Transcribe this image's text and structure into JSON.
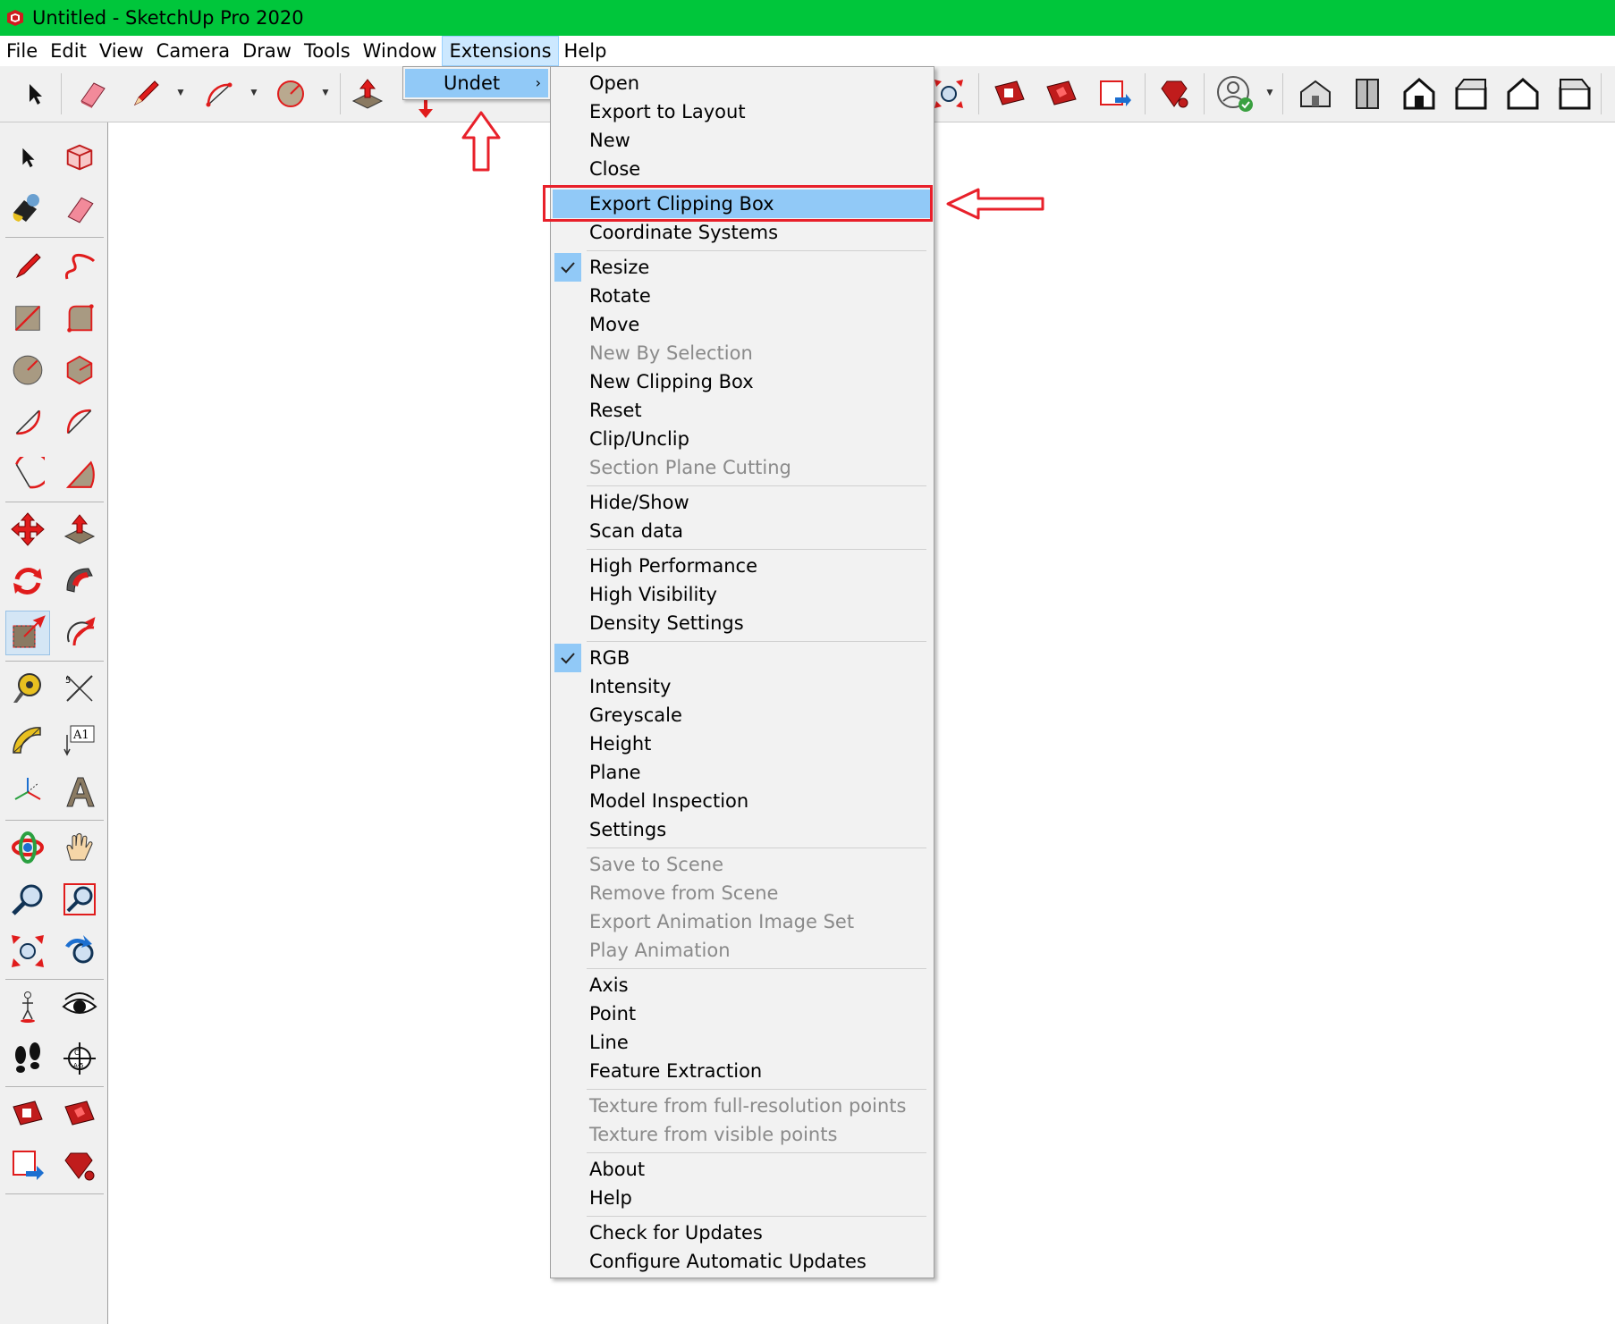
{
  "window": {
    "title": "Untitled - SketchUp Pro 2020"
  },
  "menubar": {
    "items": [
      "File",
      "Edit",
      "View",
      "Camera",
      "Draw",
      "Tools",
      "Window",
      "Extensions",
      "Help"
    ],
    "active": "Extensions"
  },
  "toolbar": {
    "icons": [
      "select-icon",
      "eraser-icon",
      "pencil-icon",
      "arc-icon",
      "circle-icon",
      "push-pull-icon",
      "undet-icon",
      "warehouse-icon",
      "extension-warehouse-icon",
      "layout-send-icon",
      "ruby-console-icon",
      "account-icon",
      "iso-view-icon",
      "top-view-icon",
      "front-view-icon",
      "right-view-icon",
      "back-view-icon",
      "left-view-icon"
    ]
  },
  "extensions_submenu": {
    "label": "Undet"
  },
  "undet_menu": {
    "items": [
      {
        "label": "Open",
        "state": "normal"
      },
      {
        "label": "Export to Layout",
        "state": "normal"
      },
      {
        "label": "New",
        "state": "normal"
      },
      {
        "label": "Close",
        "state": "normal"
      },
      {
        "label": "Export Clipping Box",
        "state": "highlight"
      },
      {
        "label": "Coordinate Systems",
        "state": "normal"
      },
      {
        "label": "Resize",
        "state": "checked"
      },
      {
        "label": "Rotate",
        "state": "normal"
      },
      {
        "label": "Move",
        "state": "normal"
      },
      {
        "label": "New By Selection",
        "state": "disabled"
      },
      {
        "label": "New Clipping Box",
        "state": "normal"
      },
      {
        "label": "Reset",
        "state": "normal"
      },
      {
        "label": "Clip/Unclip",
        "state": "normal"
      },
      {
        "label": "Section Plane Cutting",
        "state": "disabled"
      },
      {
        "label": "Hide/Show",
        "state": "normal"
      },
      {
        "label": "Scan data",
        "state": "normal"
      },
      {
        "label": "High Performance",
        "state": "normal"
      },
      {
        "label": "High Visibility",
        "state": "normal"
      },
      {
        "label": "Density Settings",
        "state": "normal"
      },
      {
        "label": "RGB",
        "state": "checked"
      },
      {
        "label": "Intensity",
        "state": "normal"
      },
      {
        "label": "Greyscale",
        "state": "normal"
      },
      {
        "label": "Height",
        "state": "normal"
      },
      {
        "label": "Plane",
        "state": "normal"
      },
      {
        "label": "Model Inspection",
        "state": "normal"
      },
      {
        "label": "Settings",
        "state": "normal"
      },
      {
        "label": "Save to Scene",
        "state": "disabled"
      },
      {
        "label": "Remove from Scene",
        "state": "disabled"
      },
      {
        "label": "Export Animation Image Set",
        "state": "disabled"
      },
      {
        "label": "Play Animation",
        "state": "disabled"
      },
      {
        "label": "Axis",
        "state": "normal"
      },
      {
        "label": "Point",
        "state": "normal"
      },
      {
        "label": "Line",
        "state": "normal"
      },
      {
        "label": "Feature Extraction",
        "state": "normal"
      },
      {
        "label": "Texture from full-resolution points",
        "state": "disabled"
      },
      {
        "label": "Texture from visible points",
        "state": "disabled"
      },
      {
        "label": "About",
        "state": "normal"
      },
      {
        "label": "Help",
        "state": "normal"
      },
      {
        "label": "Check for Updates",
        "state": "normal"
      },
      {
        "label": "Configure Automatic Updates",
        "state": "normal"
      }
    ]
  },
  "colors": {
    "titlebar": "#00c63b",
    "highlight": "#91c9f7",
    "annotation": "#e8202a",
    "disabled": "#8a8a8a"
  }
}
